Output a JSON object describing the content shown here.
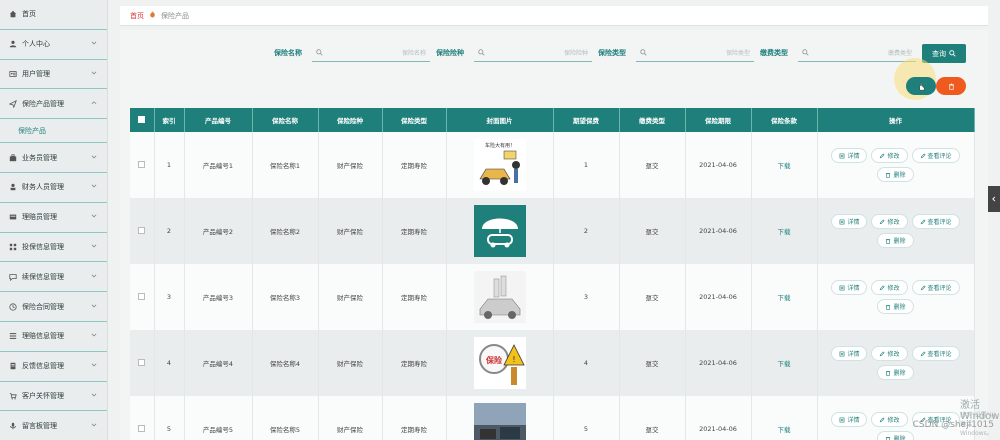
{
  "colors": {
    "primary": "#1e7f7b",
    "danger": "#ef5a1f",
    "sidebar_bg": "#eaeded"
  },
  "sidebar": {
    "items": [
      {
        "label": "首页",
        "icon": "home-icon",
        "expandable": false
      },
      {
        "label": "个人中心",
        "icon": "user-icon",
        "expandable": true
      },
      {
        "label": "用户管理",
        "icon": "user-card-icon",
        "expandable": true
      },
      {
        "label": "保险产品管理",
        "icon": "send-icon",
        "expandable": true,
        "expanded": true,
        "children": [
          "保险产品"
        ]
      },
      {
        "label": "业务员管理",
        "icon": "briefcase-icon",
        "expandable": true
      },
      {
        "label": "财务人员管理",
        "icon": "person-icon",
        "expandable": true
      },
      {
        "label": "理赔员管理",
        "icon": "card-icon",
        "expandable": true
      },
      {
        "label": "投保信息管理",
        "icon": "grid-icon",
        "expandable": true
      },
      {
        "label": "续保信息管理",
        "icon": "chat-icon",
        "expandable": true
      },
      {
        "label": "保险合同管理",
        "icon": "clock-icon",
        "expandable": true
      },
      {
        "label": "理赔信息管理",
        "icon": "list-icon",
        "expandable": true
      },
      {
        "label": "反馈信息管理",
        "icon": "doc-icon",
        "expandable": true
      },
      {
        "label": "客户关怀管理",
        "icon": "cart-icon",
        "expandable": true
      },
      {
        "label": "留言板管理",
        "icon": "mic-icon",
        "expandable": true
      }
    ]
  },
  "breadcrumb": {
    "home": "首页",
    "current": "保险产品"
  },
  "search": {
    "fields": [
      {
        "label": "保险名称",
        "placeholder": "保险名称"
      },
      {
        "label": "保险险种",
        "placeholder": "保险险种"
      },
      {
        "label": "保险类型",
        "placeholder": "保险类型"
      },
      {
        "label": "缴费类型",
        "placeholder": "缴费类型"
      }
    ],
    "button_label": "查询"
  },
  "table": {
    "headers": [
      "索引",
      "产品编号",
      "保险名称",
      "保险险种",
      "保险类型",
      "封面图片",
      "期望保费",
      "缴费类型",
      "保险期限",
      "保险条款",
      "操作"
    ],
    "rows": [
      {
        "index": "1",
        "code": "产品编号1",
        "name": "保险名称1",
        "kind": "财产保险",
        "type": "定期寿险",
        "image": "car-accident-cartoon",
        "premium": "1",
        "pay": "趸交",
        "date": "2021-04-06",
        "terms": "下载"
      },
      {
        "index": "2",
        "code": "产品编号2",
        "name": "保险名称2",
        "kind": "财产保险",
        "type": "定期寿险",
        "image": "umbrella-car-icon",
        "premium": "2",
        "pay": "趸交",
        "date": "2021-04-06",
        "terms": "下载"
      },
      {
        "index": "3",
        "code": "产品编号3",
        "name": "保险名称3",
        "kind": "财产保险",
        "type": "定期寿险",
        "image": "car-coins-sketch",
        "premium": "3",
        "pay": "趸交",
        "date": "2021-04-06",
        "terms": "下载"
      },
      {
        "index": "4",
        "code": "产品编号4",
        "name": "保险名称4",
        "kind": "财产保险",
        "type": "定期寿险",
        "image": "insurance-magnifier-sign",
        "premium": "4",
        "pay": "趸交",
        "date": "2021-04-06",
        "terms": "下载"
      },
      {
        "index": "5",
        "code": "产品编号5",
        "name": "保险名称5",
        "kind": "财产保险",
        "type": "定期寿险",
        "image": "traffic-photo",
        "premium": "5",
        "pay": "趸交",
        "date": "2021-04-06",
        "terms": "下载"
      }
    ],
    "ops": {
      "detail": "详情",
      "edit": "修改",
      "review": "查看评论",
      "delete": "删除"
    }
  },
  "watermark": {
    "line1": "激活 Windows",
    "line2": "转到\"设置\"以激活 Windows。"
  },
  "csdn": "CSDN @sheji1015"
}
